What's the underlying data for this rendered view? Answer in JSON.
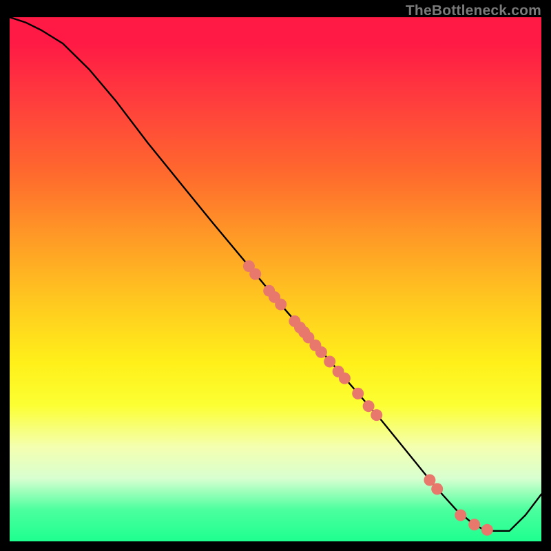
{
  "watermark": "TheBottleneck.com",
  "colors": {
    "dot_fill": "#e8786b",
    "curve_stroke": "#000000",
    "frame": "#000000"
  },
  "chart_data": {
    "type": "line",
    "title": "",
    "xlabel": "",
    "ylabel": "",
    "xlim": [
      0,
      100
    ],
    "ylim": [
      0,
      100
    ],
    "grid": false,
    "series": [
      {
        "name": "bottleneck-curve",
        "x": [
          0,
          3,
          6,
          10,
          15,
          20,
          26,
          32,
          38,
          45,
          52,
          58,
          64,
          70,
          76,
          80,
          84,
          87,
          89,
          91,
          94,
          97,
          100
        ],
        "y": [
          100,
          99,
          97.5,
          95,
          90,
          84,
          76,
          68.5,
          61,
          52.5,
          44,
          37,
          30,
          23,
          15.5,
          10.5,
          6,
          3.5,
          2.3,
          2,
          2,
          5,
          9
        ]
      }
    ],
    "points": [
      {
        "x": 45.0,
        "y": 52.5
      },
      {
        "x": 46.2,
        "y": 51.0
      },
      {
        "x": 48.8,
        "y": 47.8
      },
      {
        "x": 49.8,
        "y": 46.6
      },
      {
        "x": 51.0,
        "y": 45.2
      },
      {
        "x": 53.6,
        "y": 42.0
      },
      {
        "x": 54.6,
        "y": 40.8
      },
      {
        "x": 55.4,
        "y": 39.9
      },
      {
        "x": 56.2,
        "y": 38.9
      },
      {
        "x": 57.5,
        "y": 37.4
      },
      {
        "x": 58.6,
        "y": 36.1
      },
      {
        "x": 60.2,
        "y": 34.3
      },
      {
        "x": 61.8,
        "y": 32.4
      },
      {
        "x": 63.0,
        "y": 31.1
      },
      {
        "x": 65.5,
        "y": 28.2
      },
      {
        "x": 67.5,
        "y": 25.8
      },
      {
        "x": 69.0,
        "y": 24.1
      },
      {
        "x": 79.0,
        "y": 11.7
      },
      {
        "x": 80.4,
        "y": 10.0
      },
      {
        "x": 84.8,
        "y": 5.0
      },
      {
        "x": 87.4,
        "y": 3.2
      },
      {
        "x": 89.8,
        "y": 2.2
      }
    ],
    "legend": false
  }
}
